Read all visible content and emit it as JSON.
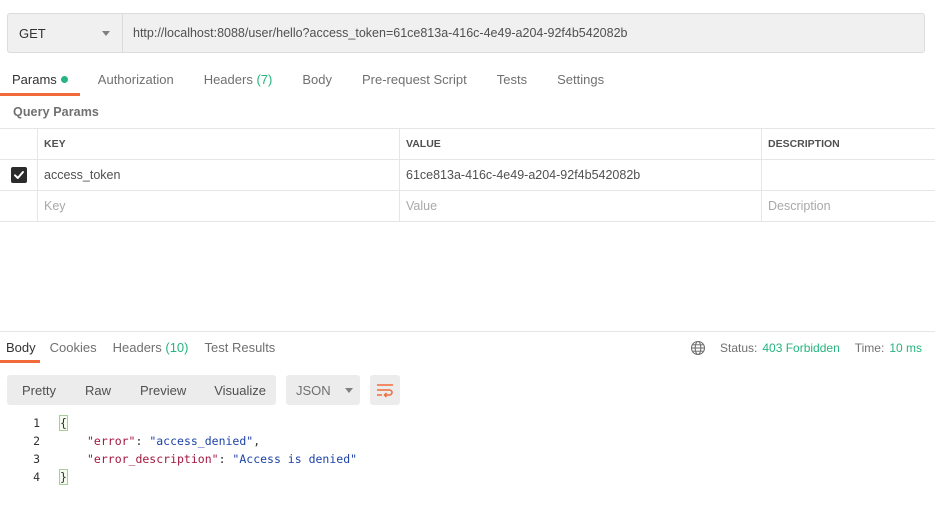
{
  "request": {
    "method": "GET",
    "url": "http://localhost:8088/user/hello?access_token=61ce813a-416c-4e49-a204-92f4b542082b"
  },
  "request_tabs": [
    {
      "label": "Params",
      "active": true,
      "has_dot": true
    },
    {
      "label": "Authorization"
    },
    {
      "label": "Headers",
      "count": "(7)"
    },
    {
      "label": "Body"
    },
    {
      "label": "Pre-request Script"
    },
    {
      "label": "Tests"
    },
    {
      "label": "Settings"
    }
  ],
  "query_params": {
    "label": "Query Params",
    "headers": {
      "key": "KEY",
      "value": "VALUE",
      "description": "DESCRIPTION"
    },
    "rows": [
      {
        "checked": true,
        "key": "access_token",
        "value": "61ce813a-416c-4e49-a204-92f4b542082b",
        "description": ""
      }
    ],
    "placeholders": {
      "key": "Key",
      "value": "Value",
      "description": "Description"
    }
  },
  "response_tabs": [
    {
      "label": "Body",
      "active": true
    },
    {
      "label": "Cookies"
    },
    {
      "label": "Headers",
      "count": "(10)"
    },
    {
      "label": "Test Results"
    }
  ],
  "status": {
    "status_label": "Status:",
    "status_value": "403 Forbidden",
    "time_label": "Time:",
    "time_value": "10 ms"
  },
  "view_modes": [
    "Pretty",
    "Raw",
    "Preview",
    "Visualize"
  ],
  "format": "JSON",
  "code_lines": [
    {
      "n": "1",
      "text": "{"
    },
    {
      "n": "2",
      "key": "\"error\"",
      "value": "\"access_denied\"",
      "trail": ","
    },
    {
      "n": "3",
      "key": "\"error_description\"",
      "value": "\"Access is denied\"",
      "trail": ""
    },
    {
      "n": "4",
      "text": "}"
    }
  ],
  "colors": {
    "accent": "#f26b3a",
    "success": "#26b47f"
  }
}
